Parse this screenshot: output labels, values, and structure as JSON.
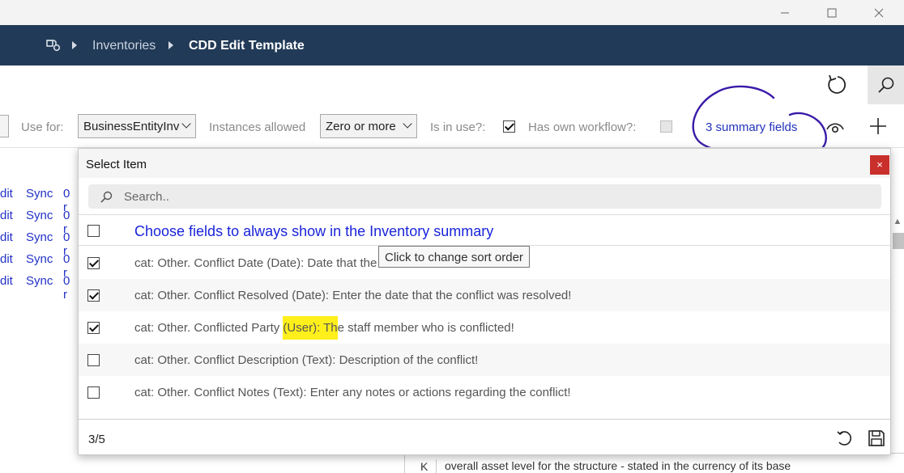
{
  "window": {
    "minimize_icon": "minimize-icon",
    "maximize_icon": "maximize-icon",
    "close_icon": "close-icon"
  },
  "breadcrumb": {
    "home_icon": "inventory-home-icon",
    "items": [
      "Inventories"
    ],
    "current": "CDD Edit Template"
  },
  "toolbar": {
    "refresh_icon": "refresh-icon",
    "search_icon": "search-icon"
  },
  "filters": {
    "use_for_label": "Use for:",
    "use_for_value": "BusinessEntityInv",
    "instances_label": "Instances allowed",
    "instances_value": "Zero or more",
    "in_use_label": "Is in use?:",
    "in_use_checked": true,
    "own_workflow_label": "Has own workflow?:",
    "own_workflow_checked": false,
    "summary_link": "3 summary fields",
    "eye_icon": "visibility-icon",
    "add_icon": "add-icon",
    "annotation_color": "#3a1aa8"
  },
  "background_rows": [
    {
      "a": "dit",
      "b": "Sync",
      "c": "0 r"
    },
    {
      "a": "dit",
      "b": "Sync",
      "c": "0 r"
    },
    {
      "a": "dit",
      "b": "Sync",
      "c": "0 r"
    },
    {
      "a": "dit",
      "b": "Sync",
      "c": "0 r"
    },
    {
      "a": "dit",
      "b": "Sync",
      "c": "0 r"
    }
  ],
  "bottom_strip": {
    "key": "K",
    "text": "overall asset level for the structure - stated in the currency of its base"
  },
  "dialog": {
    "title": "Select Item",
    "close_label": "×",
    "search_placeholder": "Search..",
    "select_all_label": "Choose fields to always show in the Inventory summary",
    "select_all_checked": false,
    "tooltip": "Click to change sort order",
    "items": [
      {
        "label": "cat: Other.  Conflict Date (Date): Date that the",
        "checked": true
      },
      {
        "label": "cat: Other.  Conflict Resolved (Date): Enter the date that the conflict was resolved!",
        "checked": true
      },
      {
        "label_pre": "cat: Other.  Conflicted Party ",
        "label_hl": "(User): Th",
        "label_post": "e staff member who is conflicted!",
        "checked": true,
        "highlight_color": "#ffef1a"
      },
      {
        "label": "cat: Other.  Conflict Description (Text): Description of the conflict!",
        "checked": false
      },
      {
        "label": "cat: Other.  Conflict Notes (Text): Enter any notes or actions regarding the conflict!",
        "checked": false
      }
    ],
    "counter": "3/5",
    "undo_icon": "undo-icon",
    "save_icon": "save-icon"
  },
  "colors": {
    "navbar": "#213a57",
    "link": "#2233bb",
    "close_red": "#c9302c"
  }
}
